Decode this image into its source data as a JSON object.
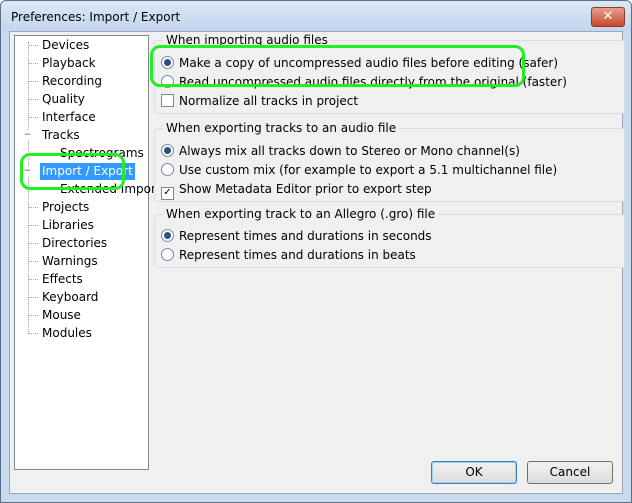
{
  "window": {
    "title": "Preferences: Import / Export",
    "close_glyph": "✕"
  },
  "tree": {
    "items": [
      {
        "label": "Devices"
      },
      {
        "label": "Playback"
      },
      {
        "label": "Recording"
      },
      {
        "label": "Quality"
      },
      {
        "label": "Interface"
      },
      {
        "label": "Tracks"
      },
      {
        "label": "Spectrograms"
      },
      {
        "label": "Import / Export"
      },
      {
        "label": "Extended Import"
      },
      {
        "label": "Projects"
      },
      {
        "label": "Libraries"
      },
      {
        "label": "Directories"
      },
      {
        "label": "Warnings"
      },
      {
        "label": "Effects"
      },
      {
        "label": "Keyboard"
      },
      {
        "label": "Mouse"
      },
      {
        "label": "Modules"
      }
    ],
    "expander_glyph": "−"
  },
  "import_group": {
    "title": "When importing audio files",
    "options": [
      {
        "label": "Make a copy of uncompressed audio files before editing (safer)",
        "checked": true
      },
      {
        "label": "Read uncompressed audio files directly from the original (faster)",
        "checked": false
      }
    ],
    "normalize_label": "Normalize all tracks in project",
    "normalize_checked": false
  },
  "export_group": {
    "title": "When exporting tracks to an audio file",
    "options": [
      {
        "label": "Always mix all tracks down to Stereo or Mono channel(s)",
        "checked": true
      },
      {
        "label": "Use custom mix (for example to export a 5.1 multichannel file)",
        "checked": false
      }
    ],
    "metadata_label": "Show Metadata Editor prior to export step",
    "metadata_checked": true,
    "check_glyph": "✓"
  },
  "allegro_group": {
    "title": "When exporting track to an Allegro (.gro) file",
    "options": [
      {
        "label": "Represent times and durations in seconds",
        "checked": true
      },
      {
        "label": "Represent times and durations in beats",
        "checked": false
      }
    ]
  },
  "buttons": {
    "ok": "OK",
    "cancel": "Cancel"
  },
  "colors": {
    "highlight": "#22ee22",
    "selection": "#3399ff"
  }
}
